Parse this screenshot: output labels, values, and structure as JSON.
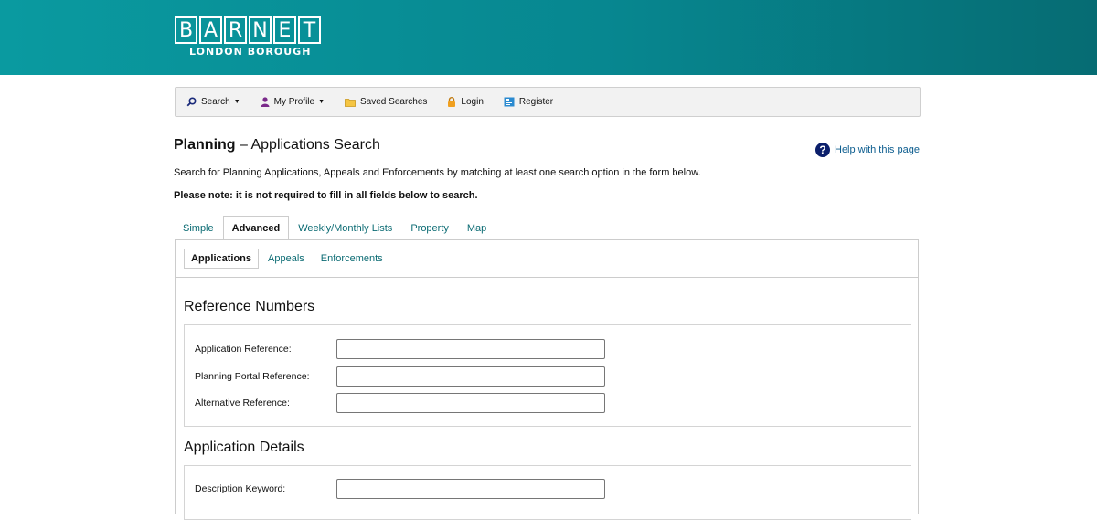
{
  "masthead": {
    "logo_letters": [
      "B",
      "A",
      "R",
      "N",
      "E",
      "T"
    ],
    "logo_subtitle": "LONDON BOROUGH"
  },
  "nav": {
    "items": [
      {
        "label": "Search",
        "icon": "search-icon",
        "dropdown": true
      },
      {
        "label": "My Profile",
        "icon": "person-icon",
        "dropdown": true
      },
      {
        "label": "Saved Searches",
        "icon": "folder-icon",
        "dropdown": false
      },
      {
        "label": "Login",
        "icon": "lock-icon",
        "dropdown": false
      },
      {
        "label": "Register",
        "icon": "register-icon",
        "dropdown": false
      }
    ]
  },
  "page": {
    "title_bold": "Planning",
    "title_rest": " – Applications Search",
    "help_label": "Help with this page",
    "intro": "Search for Planning Applications, Appeals and Enforcements by matching at least one search option in the form below.",
    "note": "Please note: it is not required to fill in all fields below to search."
  },
  "tabs": [
    "Simple",
    "Advanced",
    "Weekly/Monthly Lists",
    "Property",
    "Map"
  ],
  "active_tab": "Advanced",
  "subtabs": [
    "Applications",
    "Appeals",
    "Enforcements"
  ],
  "active_subtab": "Applications",
  "sections": {
    "reference_numbers": {
      "title": "Reference Numbers",
      "fields": [
        {
          "label": "Application Reference:",
          "value": ""
        },
        {
          "label": "Planning Portal Reference:",
          "value": ""
        },
        {
          "label": "Alternative Reference:",
          "value": ""
        }
      ]
    },
    "application_details": {
      "title": "Application Details",
      "fields": [
        {
          "label": "Description Keyword:",
          "value": ""
        }
      ]
    }
  },
  "colors": {
    "brand_teal": "#078790",
    "link": "#0b6b73",
    "help_icon": "#0b1f6b"
  }
}
